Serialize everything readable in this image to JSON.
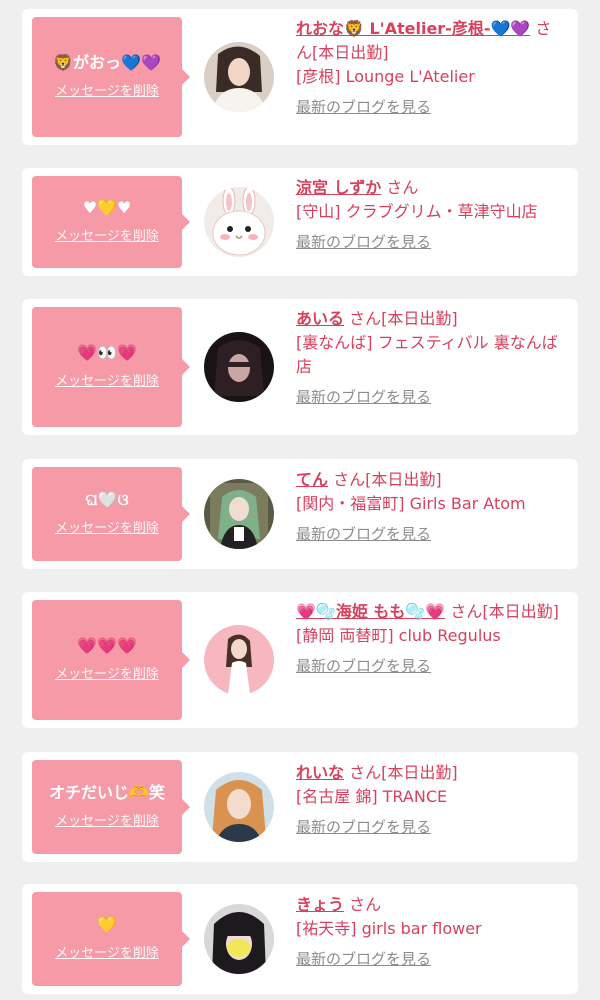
{
  "entries": [
    {
      "message": "🦁がおっ💙💜",
      "delete_label": "メッセージを削除",
      "name": "れおな🦁 L'Atelier-彦根-💙💜",
      "suffix": "さん",
      "status": "[本日出勤]",
      "location": "[彦根] Lounge L'Atelier",
      "blog_label": "最新のブログを見る",
      "avatar": "photo-woman-white-dress"
    },
    {
      "message": "♥💛♥",
      "delete_label": "メッセージを削除",
      "name": "涼宮 しずか",
      "suffix": "さん",
      "status": "",
      "location": "[守山] クラブグリム・草津守山店",
      "blog_label": "最新のブログを見る",
      "avatar": "rabbit-illustration"
    },
    {
      "message": "💗👀💗",
      "delete_label": "メッセージを削除",
      "name": "あいる",
      "suffix": "さん",
      "status": "[本日出勤]",
      "location": "[裏なんば] フェスティバル 裏なんば店",
      "blog_label": "最新のブログを見る",
      "avatar": "photo-dark-portrait"
    },
    {
      "message": "ଘ🤍ଓ",
      "delete_label": "メッセージを削除",
      "name": "てん",
      "suffix": "さん",
      "status": "[本日出勤]",
      "location": "[関内・福富町] Girls Bar Atom",
      "blog_label": "最新のブログを見る",
      "avatar": "photo-green-hair-maid"
    },
    {
      "message": "💗💗💗",
      "delete_label": "メッセージを削除",
      "name": "💗🫧海姫 もも🫧💗",
      "suffix": "さん",
      "status": "[本日出勤]",
      "location": "[静岡 両替町] club Regulus",
      "blog_label": "最新のブログを見る",
      "avatar": "photo-pink-background"
    },
    {
      "message": "オチだいじ🫶笑",
      "delete_label": "メッセージを削除",
      "name": "れいな",
      "suffix": "さん",
      "status": "[本日出勤]",
      "location": "[名古屋 錦] TRANCE",
      "blog_label": "最新のブログを見る",
      "avatar": "photo-blonde-hair"
    },
    {
      "message": "💛",
      "delete_label": "メッセージを削除",
      "name": "きょう",
      "suffix": "さん",
      "status": "",
      "location": "[祐天寺] girls bar flower",
      "blog_label": "最新のブログを見る",
      "avatar": "photo-dark-bangs-blurred"
    }
  ],
  "colors": {
    "background": "#efefef",
    "card": "#ffffff",
    "bubble": "#f69aa8",
    "accent": "#d8405e",
    "link_gray": "#8c8c8c"
  }
}
